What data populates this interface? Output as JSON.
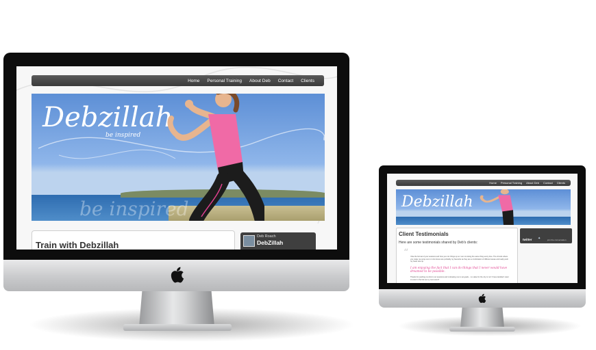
{
  "large_site": {
    "nav": [
      "Home",
      "Personal Training",
      "About Deb",
      "Contact",
      "Clients"
    ],
    "logo_text": "Debzillah",
    "tagline": "be inspired",
    "watermark": "be inspired",
    "content_title": "Train with Debzillah",
    "profile_small": "Deb Roach",
    "profile_name": "DebZillah"
  },
  "small_site": {
    "nav": [
      "Home",
      "Personal Training",
      "About Deb",
      "Contact",
      "Clients"
    ],
    "logo_text": "Debzillah",
    "section_title": "Client Testimonials",
    "section_intro": "Here are some testimonials shared by Deb's clients:",
    "quote_body": "I like the format of your sessions and how you mix things up so I am not doing the same thing every time. The circuits where you make me jump over or onto boxes are probably my favourite as they are a combination of different areas and really push my heart rate up.",
    "quote_highlight": "I am enjoying the fact that I can do things that I never would have dreamed to be possible.",
    "quote_tail": "Thanks for pushing me link in our sessions and motivating me to set goals... no value for the city to run! I have decided I want to enter in the link as my next event!!",
    "twitter_label": "twitter",
    "twitter_cta": "join the conversation"
  },
  "colors": {
    "accent_pink": "#e0408f",
    "nav_bg": "#4a4a4a",
    "bezel": "#0d0d0d"
  }
}
